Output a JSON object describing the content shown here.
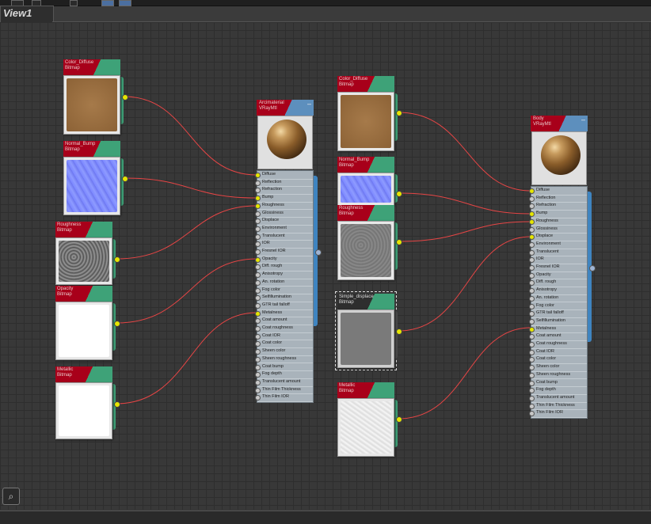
{
  "window": {
    "tab_title": "View1"
  },
  "colors": {
    "wire": "#e64545",
    "connected_port": "#e6e600",
    "bitmap_header": "#a8001a",
    "bitmap_tab": "#3ea278",
    "material_tab": "#5d8fbd"
  },
  "bitmap_nodes": [
    {
      "id": "b1",
      "title": "Color_Diffuse\nBitmap",
      "thumb": "copper"
    },
    {
      "id": "b2",
      "title": "Normal_Bump\nBitmap",
      "thumb": "normal"
    },
    {
      "id": "b3",
      "title": "Roughness\nBitmap",
      "thumb": "rough_dark"
    },
    {
      "id": "b4",
      "title": "Opacity\nBitmap",
      "thumb": "white"
    },
    {
      "id": "b5",
      "title": "Metallic\nBitmap",
      "thumb": "white"
    },
    {
      "id": "b6",
      "title": "Color_Diffuse\nBitmap",
      "thumb": "copper"
    },
    {
      "id": "b7",
      "title": "Normal_Bump\nBitmap",
      "thumb": "normal"
    },
    {
      "id": "b8",
      "title": "Roughness\nBitmap",
      "thumb": "rough_grey"
    },
    {
      "id": "b9",
      "title": "Simple_displace\nBitmap",
      "thumb": "grey"
    },
    {
      "id": "b10",
      "title": "Metallic\nBitmap",
      "thumb": "marble"
    }
  ],
  "material_nodes": [
    {
      "id": "m1",
      "title": "Arcimaterial\nVRayMtl",
      "minimize": "–",
      "slots": [
        "Diffuse",
        "Reflection",
        "Refraction",
        "Bump",
        "Roughness",
        "Glossiness",
        "Displace",
        "Environment",
        "Translucent",
        "IOR",
        "Fresnel IOR",
        "Opacity",
        "Diff. rough",
        "Anisotropy",
        "An. rotation",
        "Fog color",
        "Selfillumination",
        "GTR tail falloff",
        "Metalness",
        "Coat amount",
        "Coat roughness",
        "Coat IOR",
        "Coat color",
        "Sheen color",
        "Sheen roughness",
        "Coat bump",
        "Fog depth",
        "Translucent amount",
        "Thin Film Thickness",
        "Thin Film IOR"
      ],
      "connected": [
        0,
        3,
        4,
        11,
        18
      ]
    },
    {
      "id": "m2",
      "title": "Body\nVRayMtl",
      "minimize": "–",
      "slots": [
        "Diffuse",
        "Reflection",
        "Refraction",
        "Bump",
        "Roughness",
        "Glossiness",
        "Displace",
        "Environment",
        "Translucent",
        "IOR",
        "Fresnel IOR",
        "Opacity",
        "Diff. rough",
        "Anisotropy",
        "An. rotation",
        "Fog color",
        "GTR tail falloff",
        "Selfillumination",
        "Metalness",
        "Coat amount",
        "Coat roughness",
        "Coat IOR",
        "Coat color",
        "Sheen color",
        "Sheen roughness",
        "Coat bump",
        "Fog depth",
        "Translucent amount",
        "Thin Film Thickness",
        "Thin Film IOR"
      ],
      "connected": [
        0,
        3,
        4,
        6,
        18
      ]
    }
  ],
  "toolbar": {
    "corner_icon": "binoculars-icon"
  }
}
